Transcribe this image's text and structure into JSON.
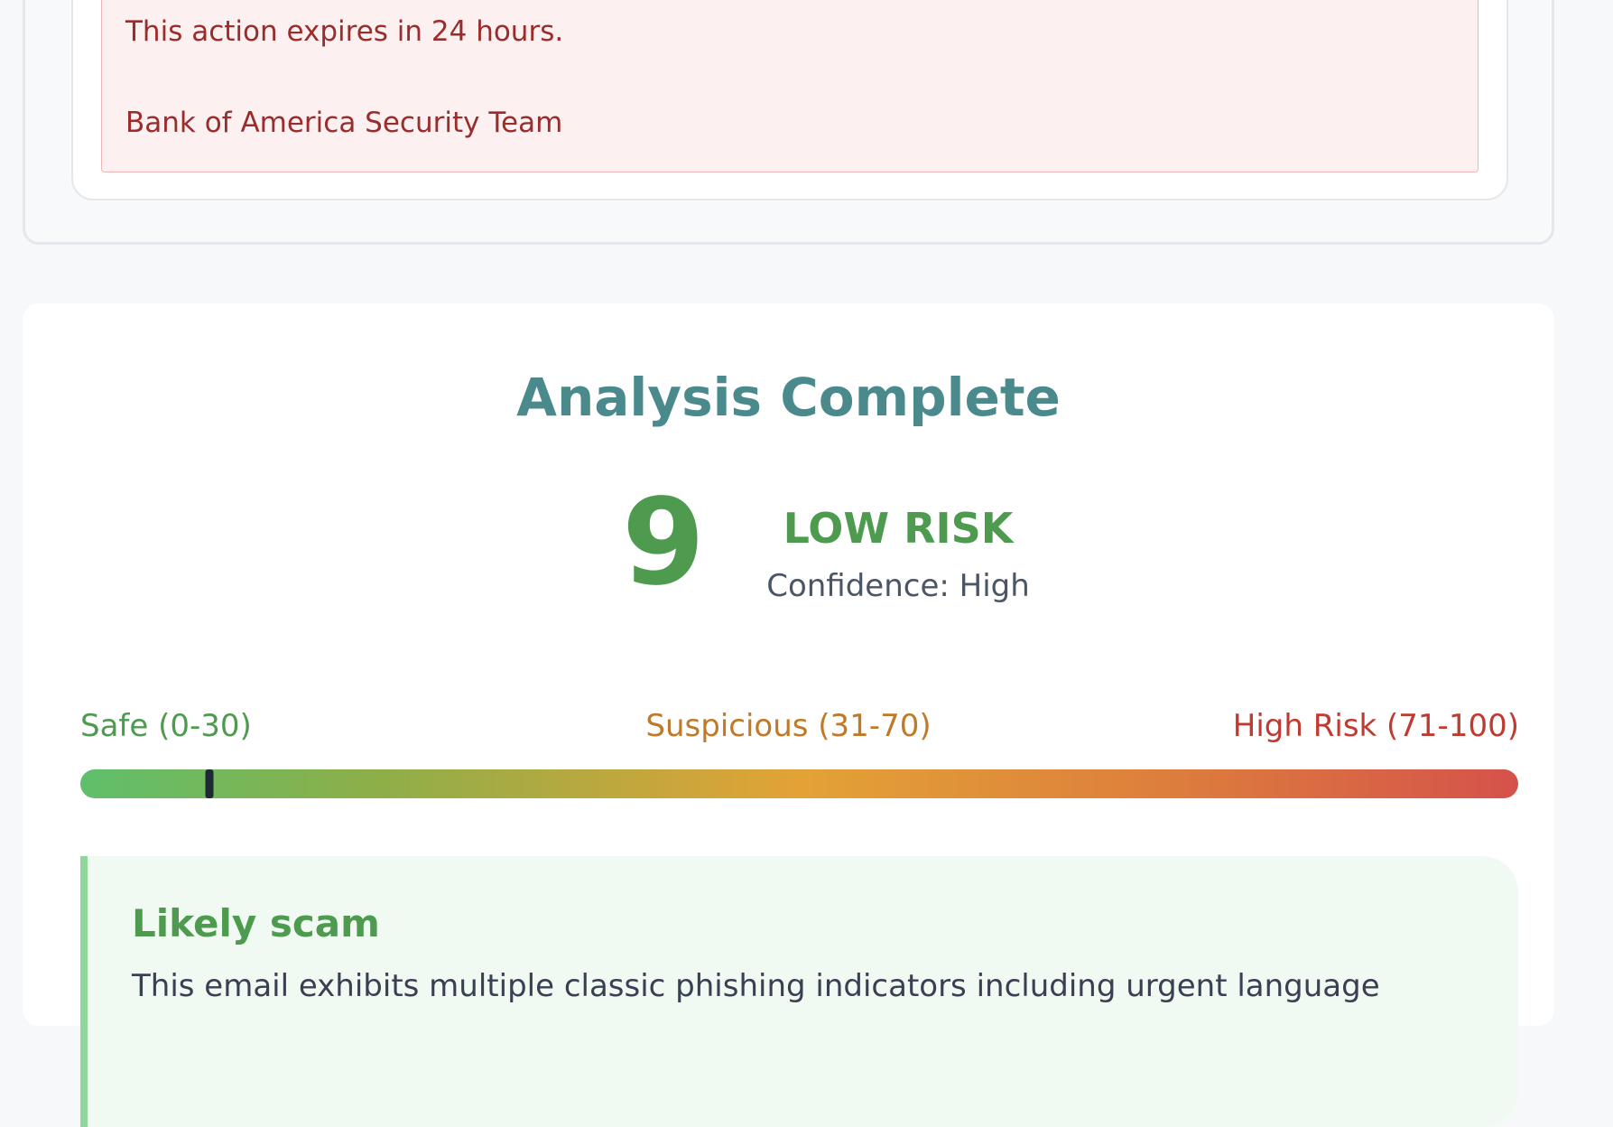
{
  "email_preview": {
    "lines": [
      "This action expires in 24 hours.",
      "Bank of America Security Team"
    ]
  },
  "result": {
    "title": "Analysis Complete",
    "score": "9",
    "risk_level": "LOW RISK",
    "confidence": "Confidence: High",
    "score_fraction": 0.09,
    "scale": {
      "safe": "Safe (0-30)",
      "suspicious": "Suspicious (31-70)",
      "high": "High Risk (71-100)"
    },
    "colors": {
      "title": "#4a8a8c",
      "low_risk": "#4e9b4f",
      "suspicious": "#c07a27",
      "high_risk": "#c03a30"
    },
    "summary": {
      "title": "Likely scam",
      "text": "This email exhibits multiple classic phishing indicators including urgent language"
    }
  }
}
